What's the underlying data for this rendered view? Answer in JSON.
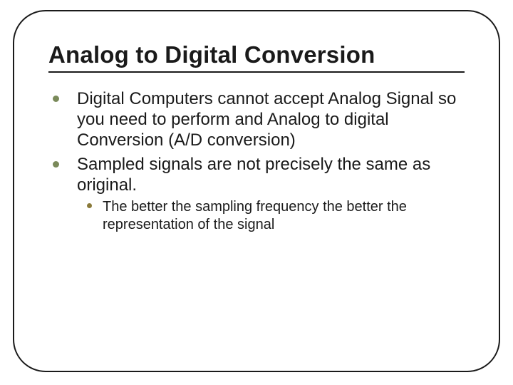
{
  "title": "Analog to Digital Conversion",
  "bullets": {
    "item1": "Digital Computers cannot accept Analog Signal so you need to perform and Analog to digital Conversion (A/D conversion)",
    "item2": "Sampled signals are not precisely the same as original.",
    "sub2_1": "The better the sampling frequency the better the representation of the signal"
  }
}
